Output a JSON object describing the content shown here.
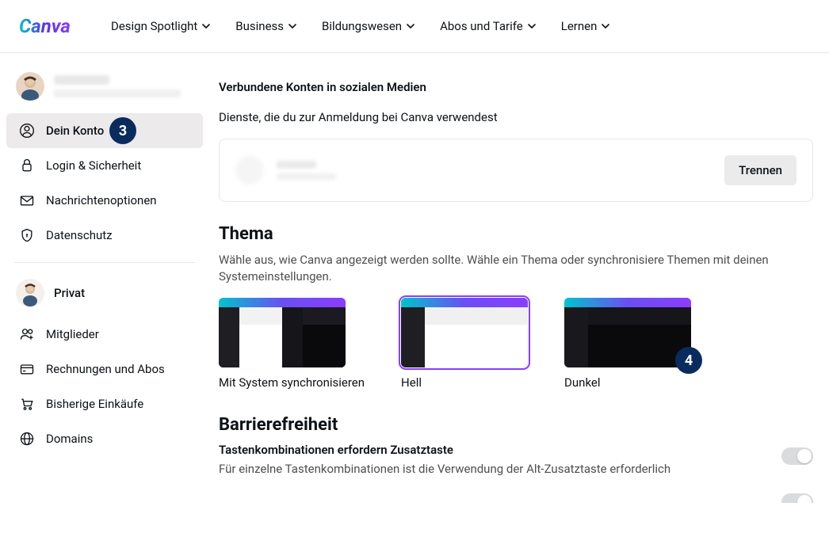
{
  "nav": {
    "items": [
      {
        "label": "Design Spotlight"
      },
      {
        "label": "Business"
      },
      {
        "label": "Bildungswesen"
      },
      {
        "label": "Abos und Tarife"
      },
      {
        "label": "Lernen"
      }
    ]
  },
  "sidebar": {
    "items": [
      {
        "label": "Dein Konto"
      },
      {
        "label": "Login & Sicherheit"
      },
      {
        "label": "Nachrichtenoptionen"
      },
      {
        "label": "Datenschutz"
      }
    ],
    "team_label": "Privat",
    "team_items": [
      {
        "label": "Mitglieder"
      },
      {
        "label": "Rechnungen und Abos"
      },
      {
        "label": "Bisherige Einkäufe"
      },
      {
        "label": "Domains"
      }
    ]
  },
  "steps": {
    "three": "3",
    "four": "4"
  },
  "connected": {
    "title": "Verbundene Konten in sozialen Medien",
    "subtitle": "Dienste, die du zur Anmeldung bei Canva verwendest",
    "disconnect": "Trennen"
  },
  "theme": {
    "title": "Thema",
    "desc": "Wähle aus, wie Canva angezeigt werden sollte. Wähle ein Thema oder synchronisiere Themen mit deinen Systemeinstellungen.",
    "options": [
      {
        "label": "Mit System synchronisieren"
      },
      {
        "label": "Hell"
      },
      {
        "label": "Dunkel"
      }
    ]
  },
  "a11y": {
    "title": "Barrierefreiheit",
    "shortcut_label": "Tastenkombinationen erfordern Zusatztaste",
    "shortcut_desc": "Für einzelne Tastenkombinationen ist die Verwendung der Alt-Zusatztaste erforderlich"
  }
}
